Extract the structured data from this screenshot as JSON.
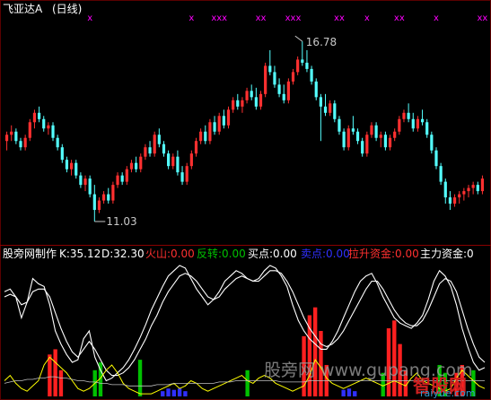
{
  "colors": {
    "up": "#ff3030",
    "down": "#54ffff",
    "marker": "#ff00ff",
    "white": "#ffffff",
    "yellow": "#ffff00",
    "green": "#00c000",
    "red": "#ff2020",
    "blue": "#3030ff",
    "magenta": "#ff00ff",
    "gray": "#c0c0c0"
  },
  "header": {
    "title": "飞亚达A",
    "period": "(日线)"
  },
  "price_annotations": {
    "high": "16.78",
    "low": "11.03"
  },
  "indicator_bar": {
    "name": "股旁网制作",
    "items": [
      {
        "label": "K:",
        "value": "35.12",
        "color": "#ffffff"
      },
      {
        "label": "D:",
        "value": "32.30",
        "color": "#ffffff"
      },
      {
        "label": "火山:",
        "value": "0.00",
        "color": "#ff3030"
      },
      {
        "label": "反转:",
        "value": "0.00",
        "color": "#00c000"
      },
      {
        "label": "买点:",
        "value": "0.00",
        "color": "#ffffff"
      },
      {
        "label": "卖点:",
        "value": "0.00",
        "color": "#3030ff"
      },
      {
        "label": "拉升资金:",
        "value": "0.00",
        "color": "#ff3030"
      },
      {
        "label": "主力资金:",
        "value": "0",
        "color": "#ffffff"
      }
    ]
  },
  "watermark": "股旁网 www.gupang.com",
  "logo": {
    "text": "智股网",
    "sub": "raiyue.com"
  },
  "chart_data": [
    {
      "type": "candlestick",
      "title": "飞亚达A (日线)",
      "high_label": 16.78,
      "low_label": 11.03,
      "ylim": [
        10.6,
        17.3
      ],
      "candles": [
        [
          13.6,
          13.9,
          13.3,
          13.8
        ],
        [
          13.8,
          14.1,
          13.6,
          13.9
        ],
        [
          13.9,
          14.0,
          13.5,
          13.6
        ],
        [
          13.6,
          13.7,
          13.3,
          13.4
        ],
        [
          13.4,
          13.8,
          13.3,
          13.7
        ],
        [
          13.7,
          14.3,
          13.6,
          14.2
        ],
        [
          14.2,
          14.6,
          14.0,
          14.5
        ],
        [
          14.5,
          14.7,
          14.2,
          14.3
        ],
        [
          14.3,
          14.4,
          13.9,
          14.0
        ],
        [
          14.0,
          14.2,
          13.8,
          14.1
        ],
        [
          14.1,
          14.2,
          13.6,
          13.7
        ],
        [
          13.7,
          13.8,
          13.3,
          13.4
        ],
        [
          13.4,
          13.5,
          12.9,
          13.0
        ],
        [
          13.0,
          13.1,
          12.6,
          12.7
        ],
        [
          12.7,
          13.0,
          12.5,
          12.9
        ],
        [
          12.9,
          13.0,
          12.4,
          12.5
        ],
        [
          12.5,
          12.6,
          12.1,
          12.2
        ],
        [
          12.2,
          12.5,
          12.0,
          12.4
        ],
        [
          12.4,
          12.5,
          11.8,
          11.9
        ],
        [
          11.9,
          12.2,
          11.03,
          11.4
        ],
        [
          11.4,
          11.8,
          11.3,
          11.7
        ],
        [
          11.7,
          12.0,
          11.6,
          11.9
        ],
        [
          11.9,
          12.1,
          11.6,
          11.7
        ],
        [
          11.7,
          12.3,
          11.6,
          12.2
        ],
        [
          12.2,
          12.6,
          12.1,
          12.5
        ],
        [
          12.5,
          12.6,
          12.2,
          12.3
        ],
        [
          12.3,
          12.8,
          12.2,
          12.7
        ],
        [
          12.7,
          13.0,
          12.6,
          12.9
        ],
        [
          12.9,
          13.1,
          12.6,
          12.7
        ],
        [
          12.7,
          13.2,
          12.6,
          13.1
        ],
        [
          13.1,
          13.5,
          13.0,
          13.4
        ],
        [
          13.4,
          13.6,
          13.1,
          13.2
        ],
        [
          13.2,
          13.9,
          13.1,
          13.8
        ],
        [
          13.8,
          14.0,
          13.4,
          13.5
        ],
        [
          13.5,
          13.6,
          13.1,
          13.2
        ],
        [
          13.2,
          13.3,
          12.7,
          12.8
        ],
        [
          12.8,
          13.2,
          12.7,
          13.1
        ],
        [
          13.1,
          13.3,
          12.5,
          12.6
        ],
        [
          12.6,
          12.8,
          12.2,
          12.3
        ],
        [
          12.3,
          12.9,
          12.2,
          12.8
        ],
        [
          12.8,
          13.3,
          12.7,
          13.2
        ],
        [
          13.2,
          13.7,
          13.1,
          13.6
        ],
        [
          13.6,
          14.0,
          13.5,
          13.9
        ],
        [
          13.9,
          14.1,
          13.5,
          13.6
        ],
        [
          13.6,
          14.3,
          13.5,
          14.2
        ],
        [
          14.2,
          14.4,
          13.8,
          13.9
        ],
        [
          13.9,
          14.5,
          13.8,
          14.4
        ],
        [
          14.4,
          14.6,
          14.0,
          14.1
        ],
        [
          14.1,
          14.7,
          14.0,
          14.6
        ],
        [
          14.6,
          15.0,
          14.5,
          14.9
        ],
        [
          14.9,
          15.1,
          14.6,
          14.7
        ],
        [
          14.7,
          15.0,
          14.5,
          14.9
        ],
        [
          14.9,
          15.3,
          14.8,
          15.2
        ],
        [
          15.2,
          15.4,
          14.9,
          15.0
        ],
        [
          15.0,
          15.3,
          14.6,
          14.7
        ],
        [
          14.7,
          15.2,
          14.6,
          15.1
        ],
        [
          15.1,
          16.1,
          15.0,
          16.0
        ],
        [
          16.0,
          16.5,
          15.7,
          15.8
        ],
        [
          15.8,
          16.0,
          15.3,
          15.4
        ],
        [
          15.4,
          15.6,
          15.0,
          15.1
        ],
        [
          15.1,
          15.4,
          14.8,
          14.9
        ],
        [
          14.9,
          15.6,
          14.8,
          15.5
        ],
        [
          15.5,
          15.9,
          15.4,
          15.8
        ],
        [
          15.8,
          16.3,
          15.7,
          16.2
        ],
        [
          16.2,
          16.78,
          16.0,
          16.1
        ],
        [
          16.1,
          16.5,
          15.8,
          15.9
        ],
        [
          15.9,
          16.0,
          15.4,
          15.5
        ],
        [
          15.5,
          15.6,
          14.9,
          15.0
        ],
        [
          15.0,
          15.1,
          13.6,
          14.7
        ],
        [
          14.7,
          15.1,
          14.4,
          14.5
        ],
        [
          14.5,
          14.9,
          14.4,
          14.8
        ],
        [
          14.8,
          14.9,
          14.2,
          14.3
        ],
        [
          14.3,
          14.4,
          13.8,
          13.9
        ],
        [
          13.9,
          14.0,
          13.3,
          13.4
        ],
        [
          13.4,
          14.1,
          13.3,
          14.0
        ],
        [
          14.0,
          14.4,
          13.8,
          13.9
        ],
        [
          13.9,
          14.0,
          13.5,
          13.6
        ],
        [
          13.6,
          13.7,
          13.1,
          13.2
        ],
        [
          13.2,
          13.9,
          13.1,
          13.8
        ],
        [
          13.8,
          14.2,
          13.7,
          14.1
        ],
        [
          14.1,
          14.2,
          13.6,
          13.7
        ],
        [
          13.7,
          13.9,
          13.4,
          13.8
        ],
        [
          13.8,
          13.9,
          13.3,
          13.4
        ],
        [
          13.4,
          13.8,
          13.3,
          13.7
        ],
        [
          13.7,
          14.0,
          13.6,
          13.9
        ],
        [
          13.9,
          14.4,
          13.8,
          14.3
        ],
        [
          14.3,
          14.6,
          14.2,
          14.5
        ],
        [
          14.5,
          14.8,
          14.2,
          14.3
        ],
        [
          14.3,
          14.5,
          13.9,
          14.0
        ],
        [
          14.0,
          14.4,
          13.9,
          14.3
        ],
        [
          14.3,
          14.6,
          14.1,
          14.2
        ],
        [
          14.2,
          14.3,
          13.7,
          13.8
        ],
        [
          13.8,
          13.9,
          13.2,
          13.3
        ],
        [
          13.3,
          13.4,
          12.7,
          12.8
        ],
        [
          12.8,
          12.9,
          12.2,
          12.3
        ],
        [
          12.3,
          12.4,
          11.6,
          11.8
        ],
        [
          11.8,
          12.0,
          11.4,
          11.6
        ],
        [
          11.6,
          11.9,
          11.5,
          11.8
        ],
        [
          11.8,
          12.0,
          11.6,
          11.9
        ],
        [
          11.9,
          12.1,
          11.7,
          12.0
        ],
        [
          12.0,
          12.2,
          11.8,
          12.1
        ],
        [
          12.1,
          12.3,
          11.9,
          12.2
        ],
        [
          12.2,
          12.3,
          11.9,
          12.0
        ],
        [
          12.0,
          12.5,
          11.9,
          12.4
        ]
      ],
      "markers": [
        {
          "label": "x",
          "candle": 18
        },
        {
          "label": "x",
          "candle": 40
        },
        {
          "label": "xxx",
          "candle": 46
        },
        {
          "label": "xx",
          "candle": 55
        },
        {
          "label": "xxx",
          "candle": 62
        },
        {
          "label": "xx",
          "candle": 72
        },
        {
          "label": "x",
          "candle": 78
        },
        {
          "label": "xx",
          "candle": 85
        },
        {
          "label": "x",
          "candle": 93
        },
        {
          "label": "xx",
          "candle": 103
        }
      ]
    },
    {
      "type": "line",
      "title": "股旁网制作",
      "ylim": [
        0,
        100
      ],
      "series": [
        {
          "name": "K",
          "color": "#ffffff",
          "width": 1.1,
          "values": [
            80,
            82,
            76,
            60,
            72,
            90,
            86,
            84,
            70,
            50,
            40,
            32,
            26,
            28,
            44,
            50,
            30,
            20,
            12,
            14,
            18,
            22,
            28,
            36,
            45,
            55,
            66,
            75,
            84,
            92,
            96,
            100,
            98,
            90,
            82,
            76,
            70,
            74,
            80,
            88,
            92,
            96,
            94,
            90,
            88,
            90,
            96,
            100,
            98,
            92,
            84,
            70,
            58,
            50,
            44,
            40,
            36,
            36,
            42,
            50,
            60,
            70,
            80,
            88,
            92,
            94,
            86,
            76,
            68,
            60,
            56,
            54,
            52,
            56,
            62,
            74,
            88,
            96,
            92,
            84,
            70,
            52,
            38,
            26,
            20,
            22
          ]
        },
        {
          "name": "D",
          "color": "#ffffff",
          "width": 1.1,
          "values": [
            76,
            78,
            76,
            70,
            72,
            80,
            82,
            82,
            76,
            64,
            52,
            42,
            34,
            30,
            36,
            42,
            36,
            28,
            20,
            16,
            16,
            18,
            22,
            28,
            36,
            44,
            54,
            62,
            72,
            80,
            86,
            92,
            94,
            92,
            88,
            82,
            76,
            74,
            76,
            82,
            86,
            90,
            92,
            90,
            88,
            88,
            92,
            96,
            96,
            94,
            88,
            80,
            70,
            60,
            52,
            46,
            40,
            38,
            40,
            44,
            50,
            58,
            66,
            74,
            82,
            88,
            88,
            82,
            74,
            66,
            60,
            56,
            54,
            54,
            58,
            66,
            76,
            86,
            90,
            88,
            80,
            66,
            52,
            40,
            30,
            26
          ]
        },
        {
          "name": "主力资金",
          "color": "#ffff00",
          "width": 1,
          "values": [
            12,
            16,
            10,
            6,
            4,
            8,
            12,
            24,
            30,
            26,
            22,
            18,
            12,
            6,
            4,
            6,
            10,
            14,
            20,
            24,
            18,
            10,
            6,
            4,
            2,
            2,
            2,
            4,
            6,
            8,
            10,
            6,
            8,
            12,
            10,
            6,
            4,
            6,
            8,
            10,
            12,
            14,
            16,
            12,
            10,
            14,
            16,
            14,
            10,
            8,
            6,
            4,
            6,
            8,
            16,
            28,
            22,
            14,
            10,
            8,
            6,
            8,
            10,
            12,
            14,
            12,
            10,
            8,
            10,
            12,
            10,
            8,
            14,
            18,
            12,
            10,
            8,
            6,
            4,
            6,
            14,
            20,
            16,
            12,
            8,
            6
          ]
        },
        {
          "name": "慢线",
          "color": "#c0c0c0",
          "width": 0.8,
          "values": [
            10,
            11,
            12,
            12,
            13,
            13,
            14,
            14,
            15,
            15,
            14,
            14,
            13,
            12,
            12,
            11,
            11,
            10,
            10,
            9,
            9,
            9,
            8,
            8,
            8,
            8,
            8,
            9,
            9,
            9,
            10,
            10,
            10,
            10,
            10,
            10,
            10,
            10,
            11,
            11,
            11,
            12,
            12,
            12,
            12,
            12,
            12,
            12,
            12,
            11,
            11,
            11,
            11,
            11,
            12,
            12,
            12,
            12,
            12,
            12,
            12,
            12,
            12,
            12,
            12,
            12,
            12,
            12,
            12,
            12,
            12,
            12,
            12,
            12,
            12,
            12,
            12,
            12,
            12,
            12,
            12,
            12,
            12,
            12,
            12,
            12
          ]
        }
      ],
      "bars": [
        {
          "name": "火山",
          "color": "#ff2020",
          "points": [
            [
              8,
              32
            ],
            [
              9,
              36
            ],
            [
              10,
              20
            ],
            [
              53,
              46
            ],
            [
              54,
              62
            ],
            [
              55,
              68
            ],
            [
              56,
              50
            ],
            [
              57,
              24
            ],
            [
              68,
              52
            ],
            [
              69,
              58
            ],
            [
              70,
              40
            ],
            [
              71,
              20
            ],
            [
              80,
              18
            ],
            [
              81,
              24
            ]
          ]
        },
        {
          "name": "反转",
          "color": "#00c000",
          "points": [
            [
              16,
              20
            ],
            [
              17,
              26
            ],
            [
              24,
              28
            ],
            [
              43,
              20
            ],
            [
              67,
              18
            ],
            [
              77,
              24
            ],
            [
              78,
              18
            ],
            [
              83,
              20
            ]
          ]
        },
        {
          "name": "卖点",
          "color": "#3030ff",
          "points": [
            [
              28,
              4
            ],
            [
              29,
              6
            ],
            [
              30,
              5
            ],
            [
              31,
              6
            ],
            [
              32,
              4
            ],
            [
              60,
              5
            ],
            [
              61,
              6
            ],
            [
              62,
              4
            ]
          ]
        }
      ]
    }
  ]
}
